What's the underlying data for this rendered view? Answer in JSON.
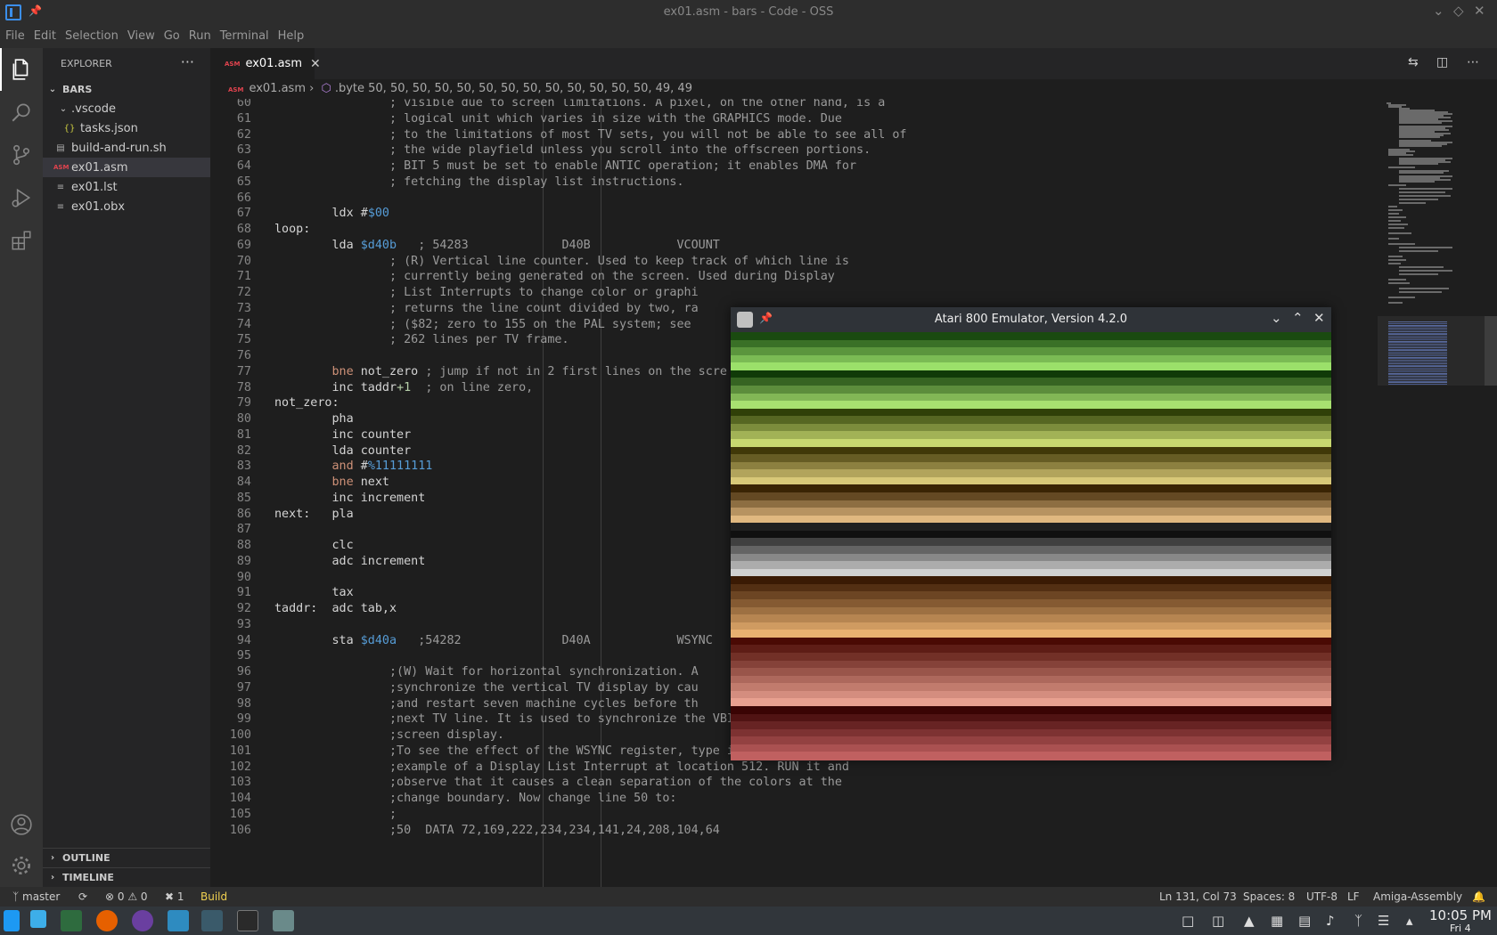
{
  "window": {
    "title": "ex01.asm - bars - Code - OSS"
  },
  "menu": [
    "File",
    "Edit",
    "Selection",
    "View",
    "Go",
    "Run",
    "Terminal",
    "Help"
  ],
  "sidebar": {
    "title": "EXPLORER",
    "more": "···",
    "root": "BARS",
    "items": [
      {
        "label": ".vscode",
        "kind": "folder"
      },
      {
        "label": "tasks.json",
        "kind": "json"
      },
      {
        "label": "build-and-run.sh",
        "kind": "file"
      },
      {
        "label": "ex01.asm",
        "kind": "asm"
      },
      {
        "label": "ex01.lst",
        "kind": "file"
      },
      {
        "label": "ex01.obx",
        "kind": "file"
      }
    ],
    "outline": "OUTLINE",
    "timeline": "TIMELINE"
  },
  "editor": {
    "tab_label": "ex01.asm",
    "badge": "ASM",
    "breadcrumb": {
      "file": "ex01.asm",
      "symbol": ".byte 50, 50, 50, 50, 50, 50, 50, 50, 50, 50, 50, 50, 50, 49, 49"
    },
    "lines": [
      {
        "n": "60",
        "t": "                ; visible due to screen limitations. A pixel, on the other hand, is a"
      },
      {
        "n": "61",
        "t": "                ; logical unit which varies in size with the GRAPHICS mode. Due"
      },
      {
        "n": "62",
        "t": "                ; to the limitations of most TV sets, you will not be able to see all of"
      },
      {
        "n": "63",
        "t": "                ; the wide playfield unless you scroll into the offscreen portions."
      },
      {
        "n": "64",
        "t": "                ; BIT 5 must be set to enable ANTIC operation; it enables DMA for"
      },
      {
        "n": "65",
        "t": "                ; fetching the display list instructions."
      },
      {
        "n": "66",
        "t": ""
      },
      {
        "n": "67",
        "t": "        ldx #$00"
      },
      {
        "n": "68",
        "t": "loop:"
      },
      {
        "n": "69",
        "t": "        lda $d40b   ; 54283             D40B            VCOUNT"
      },
      {
        "n": "70",
        "t": "                ; (R) Vertical line counter. Used to keep track of which line is"
      },
      {
        "n": "71",
        "t": "                ; currently being generated on the screen. Used during Display"
      },
      {
        "n": "72",
        "t": "                ; List Interrupts to change color or graphi"
      },
      {
        "n": "73",
        "t": "                ; returns the line count divided by two, ra"
      },
      {
        "n": "74",
        "t": "                ; ($82; zero to 155 on the PAL system; see"
      },
      {
        "n": "75",
        "t": "                ; 262 lines per TV frame."
      },
      {
        "n": "76",
        "t": ""
      },
      {
        "n": "77",
        "t": "        bne not_zero ; jump if not in 2 first lines on the scre"
      },
      {
        "n": "78",
        "t": "        inc taddr+1  ; on line zero,"
      },
      {
        "n": "79",
        "t": "not_zero:"
      },
      {
        "n": "80",
        "t": "        pha"
      },
      {
        "n": "81",
        "t": "        inc counter"
      },
      {
        "n": "82",
        "t": "        lda counter"
      },
      {
        "n": "83",
        "t": "        and #%11111111"
      },
      {
        "n": "84",
        "t": "        bne next"
      },
      {
        "n": "85",
        "t": "        inc increment"
      },
      {
        "n": "86",
        "t": "next:   pla"
      },
      {
        "n": "87",
        "t": ""
      },
      {
        "n": "88",
        "t": "        clc"
      },
      {
        "n": "89",
        "t": "        adc increment"
      },
      {
        "n": "90",
        "t": ""
      },
      {
        "n": "91",
        "t": "        tax"
      },
      {
        "n": "92",
        "t": "taddr:  adc tab,x"
      },
      {
        "n": "93",
        "t": ""
      },
      {
        "n": "94",
        "t": "        sta $d40a   ;54282              D40A            WSYNC"
      },
      {
        "n": "95",
        "t": ""
      },
      {
        "n": "96",
        "t": "                ;(W) Wait for horizontal synchronization. A"
      },
      {
        "n": "97",
        "t": "                ;synchronize the vertical TV display by cau"
      },
      {
        "n": "98",
        "t": "                ;and restart seven machine cycles before th"
      },
      {
        "n": "99",
        "t": "                ;next TV line. It is used to synchronize the VBI's or DLI's with the"
      },
      {
        "n": "100",
        "t": "                ;screen display."
      },
      {
        "n": "101",
        "t": "                ;To see the effect of the WSYNC register, type in the second"
      },
      {
        "n": "102",
        "t": "                ;example of a Display List Interrupt at location 512. RUN it and"
      },
      {
        "n": "103",
        "t": "                ;observe that it causes a clean separation of the colors at the"
      },
      {
        "n": "104",
        "t": "                ;change boundary. Now change line 50 to:"
      },
      {
        "n": "105",
        "t": "                ;"
      },
      {
        "n": "106",
        "t": "                ;50  DATA 72,169,222,234,234,141,24,208,104,64"
      }
    ]
  },
  "status": {
    "branch": "master",
    "errors": "0",
    "warnings": "0",
    "tools": "1",
    "build": "Build",
    "position": "Ln 131, Col 73",
    "spaces": "Spaces: 8",
    "encoding": "UTF-8",
    "eol": "LF",
    "language": "Amiga-Assembly"
  },
  "emulator": {
    "title": "Atari 800 Emulator, Version 4.2.0"
  },
  "taskbar": {
    "time": "10:05 PM",
    "date": "Fri 4"
  },
  "colors": {
    "accent_blue": "#007acc",
    "asm_red": "#e0434e",
    "comment_gray": "#9a9a9a",
    "keyword_orange": "#ce9178",
    "number_blue": "#569cd6"
  }
}
